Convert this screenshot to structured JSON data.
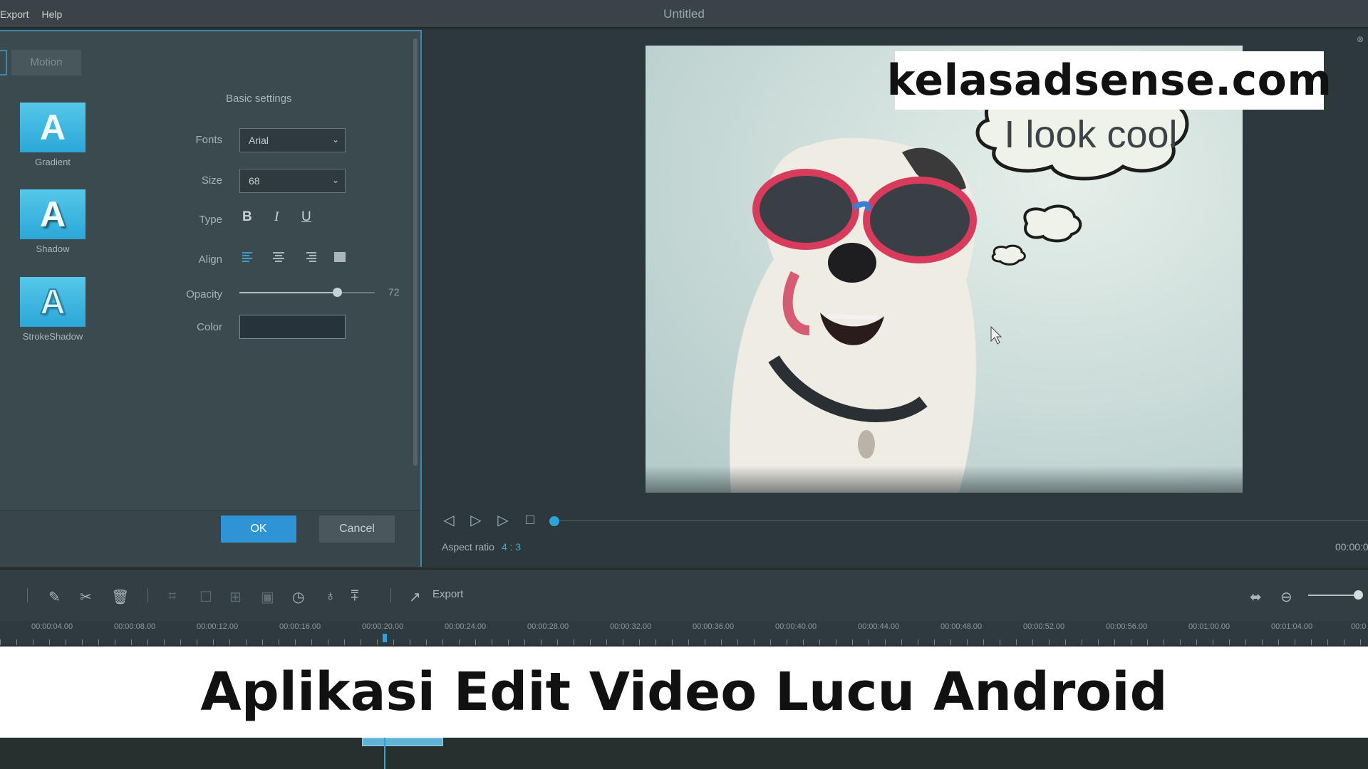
{
  "menu": {
    "export": "Export",
    "help": "Help"
  },
  "window": {
    "title": "Untitled"
  },
  "dialog": {
    "tabs": {
      "motion": "Motion"
    },
    "presets": [
      {
        "name": "Gradient",
        "letter": "A"
      },
      {
        "name": "Shadow",
        "letter": "A"
      },
      {
        "name": "StrokeShadow",
        "letter": "A"
      }
    ],
    "section_title": "Basic settings",
    "labels": {
      "fonts": "Fonts",
      "size": "Size",
      "type": "Type",
      "align": "Align",
      "opacity": "Opacity",
      "color": "Color"
    },
    "fonts_value": "Arial",
    "size_value": "68",
    "type_buttons": {
      "bold": "B",
      "italic": "I",
      "underline": "U"
    },
    "opacity_value": "72",
    "color_value": "#27333a",
    "ok_label": "OK",
    "cancel_label": "Cancel"
  },
  "preview": {
    "caption_text": "I look cool",
    "aspect_label": "Aspect ratio",
    "aspect_value": "4 : 3",
    "time_display": "00:00:0",
    "progress": 0.0
  },
  "toolbar": {
    "export_label": "Export",
    "zoom_level": 0.9
  },
  "timeline": {
    "ticks": [
      "00:00:04.00",
      "00:00:08.00",
      "00:00:12.00",
      "00:00:16.00",
      "00:00:20.00",
      "00:00:24.00",
      "00:00:28.00",
      "00:00:32.00",
      "00:00:36.00",
      "00:00:40.00",
      "00:00:44.00",
      "00:00:48.00",
      "00:00:52.00",
      "00:00:56.00",
      "00:01:00.00",
      "00:01:04.00",
      "00:0"
    ]
  },
  "overlay": {
    "watermark": "kelasadsense.com",
    "headline": "Aplikasi Edit Video Lucu Android"
  },
  "colors": {
    "accent": "#2e94d4",
    "panel": "#3b4a4e",
    "background": "#2b3438"
  }
}
